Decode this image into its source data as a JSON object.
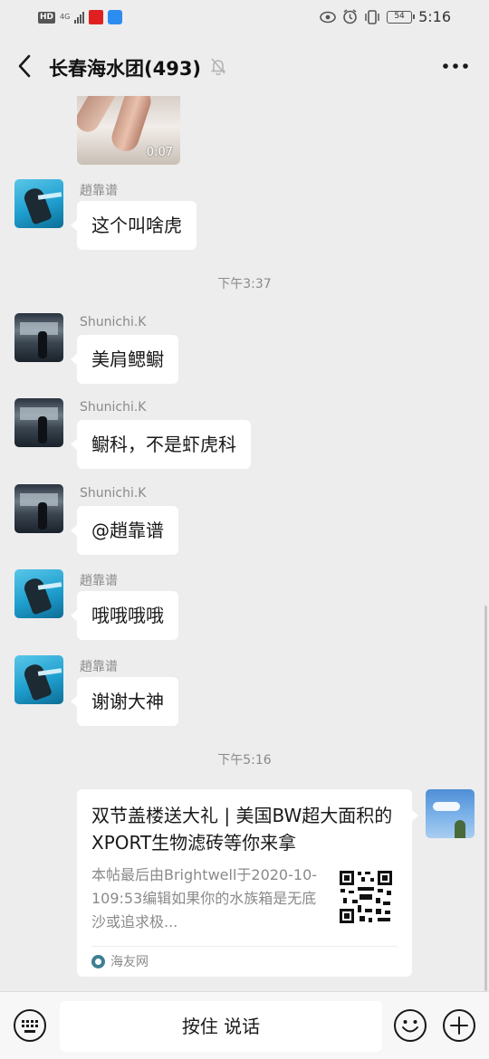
{
  "status_bar": {
    "hd": "HD",
    "network": "4G",
    "battery": "54",
    "time": "5:16"
  },
  "header": {
    "title": "长春海水团(493)",
    "back_icon": "chevron-left-icon",
    "mute_icon": "bell-off-icon",
    "more_icon": "more-dots-icon"
  },
  "chat": {
    "video": {
      "duration": "0:07"
    },
    "messages": [
      {
        "sender": "趙靠谱",
        "text": "这个叫啥虎"
      },
      {
        "sender": "Shunichi.K",
        "text": "美肩鳃鳚"
      },
      {
        "sender": "Shunichi.K",
        "text": "鳚科，不是虾虎科"
      },
      {
        "sender": "Shunichi.K",
        "text": "@趙靠谱"
      },
      {
        "sender": "趙靠谱",
        "text": "哦哦哦哦"
      },
      {
        "sender": "趙靠谱",
        "text": "谢谢大神"
      }
    ],
    "timestamps": [
      "下午3:37",
      "下午5:16"
    ],
    "link_card": {
      "title": "双节盖楼送大礼 | 美国BW超大面积的XPORT生物滤砖等你来拿",
      "description": "本帖最后由Brightwell于2020-10-109:53编辑如果你的水族箱是无底沙或追求极...",
      "source": "海友网"
    }
  },
  "input_bar": {
    "hold_to_talk": "按住 说话",
    "voice_icon": "keyboard-icon",
    "emoji_icon": "emoji-icon",
    "plus_icon": "plus-icon"
  },
  "colors": {
    "background": "#ededed",
    "bubble": "#ffffff",
    "meta_text": "#8a8a8a"
  }
}
